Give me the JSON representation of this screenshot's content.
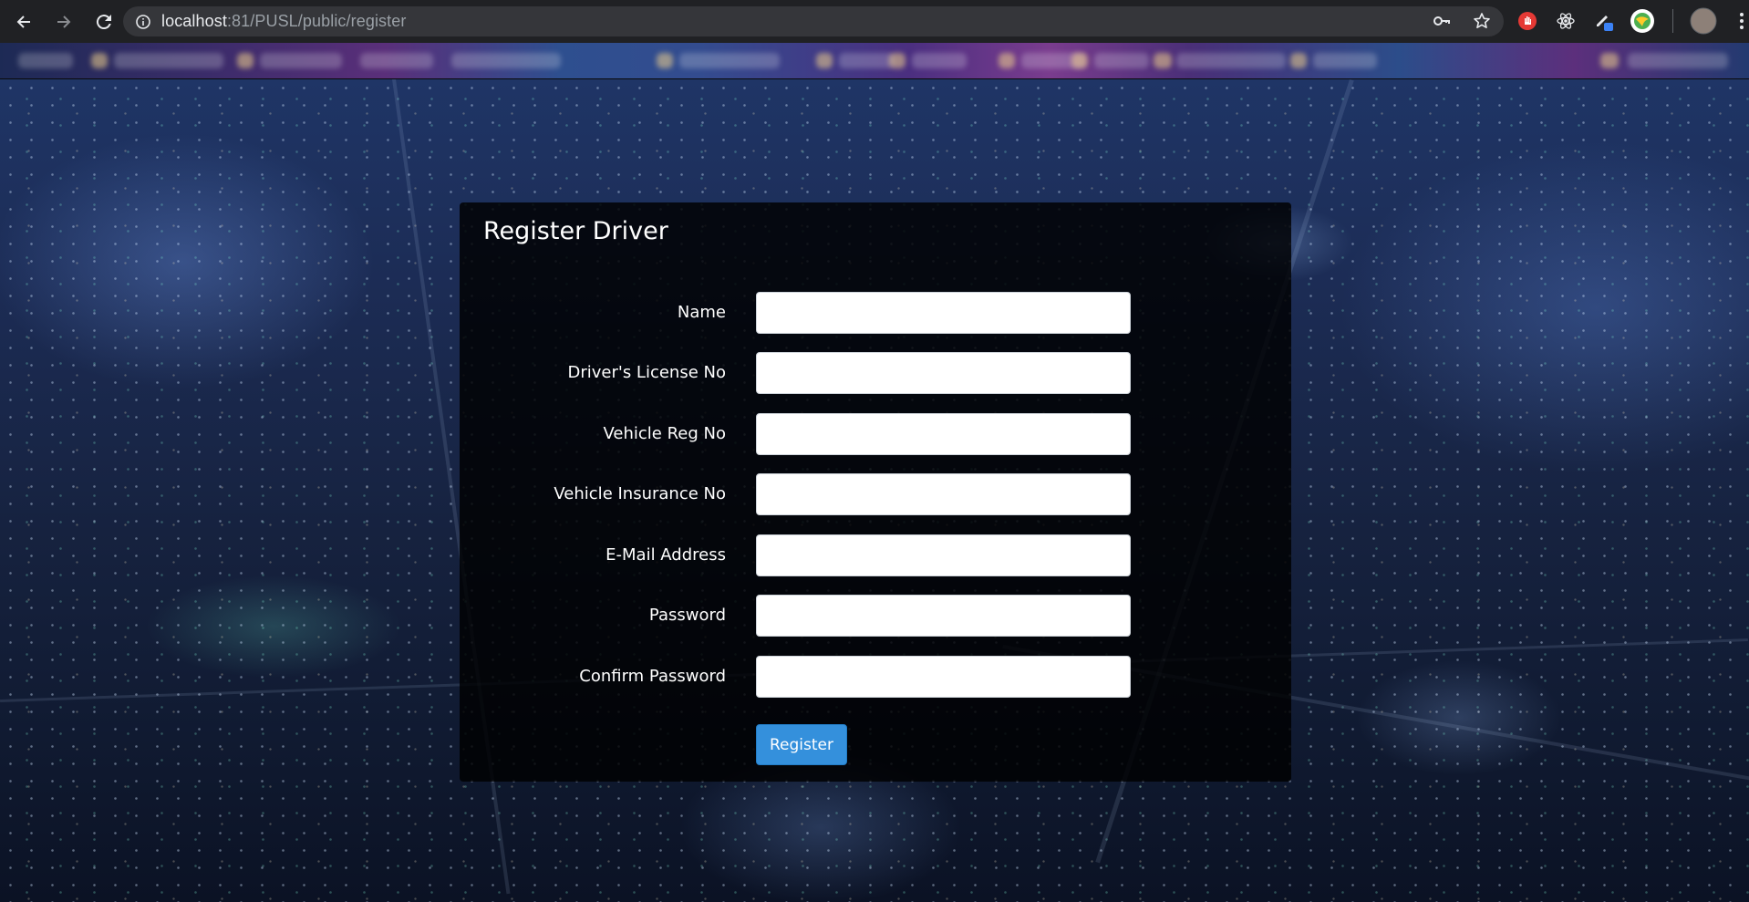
{
  "browser": {
    "url_host": "localhost",
    "url_rest": ":81/PUSL/public/register",
    "back_icon": "arrow-left",
    "forward_icon": "arrow-right",
    "reload_icon": "reload",
    "info_icon": "info-circle",
    "key_icon": "key",
    "star_icon": "star",
    "extensions": [
      "red-hand-extension",
      "react-devtools-extension",
      "pencil-extension",
      "globe-extension"
    ],
    "profile_icon": "avatar",
    "menu_icon": "kebab-menu"
  },
  "form": {
    "title": "Register Driver",
    "fields": [
      {
        "label": "Name",
        "value": ""
      },
      {
        "label": "Driver's License No",
        "value": ""
      },
      {
        "label": "Vehicle Reg No",
        "value": ""
      },
      {
        "label": "Vehicle Insurance No",
        "value": ""
      },
      {
        "label": "E-Mail Address",
        "value": ""
      },
      {
        "label": "Password",
        "value": ""
      },
      {
        "label": "Confirm Password",
        "value": ""
      }
    ],
    "submit_label": "Register"
  },
  "colors": {
    "button": "#3490dc",
    "card": "rgba(0,0,0,0.82)",
    "chrome": "#202124"
  }
}
